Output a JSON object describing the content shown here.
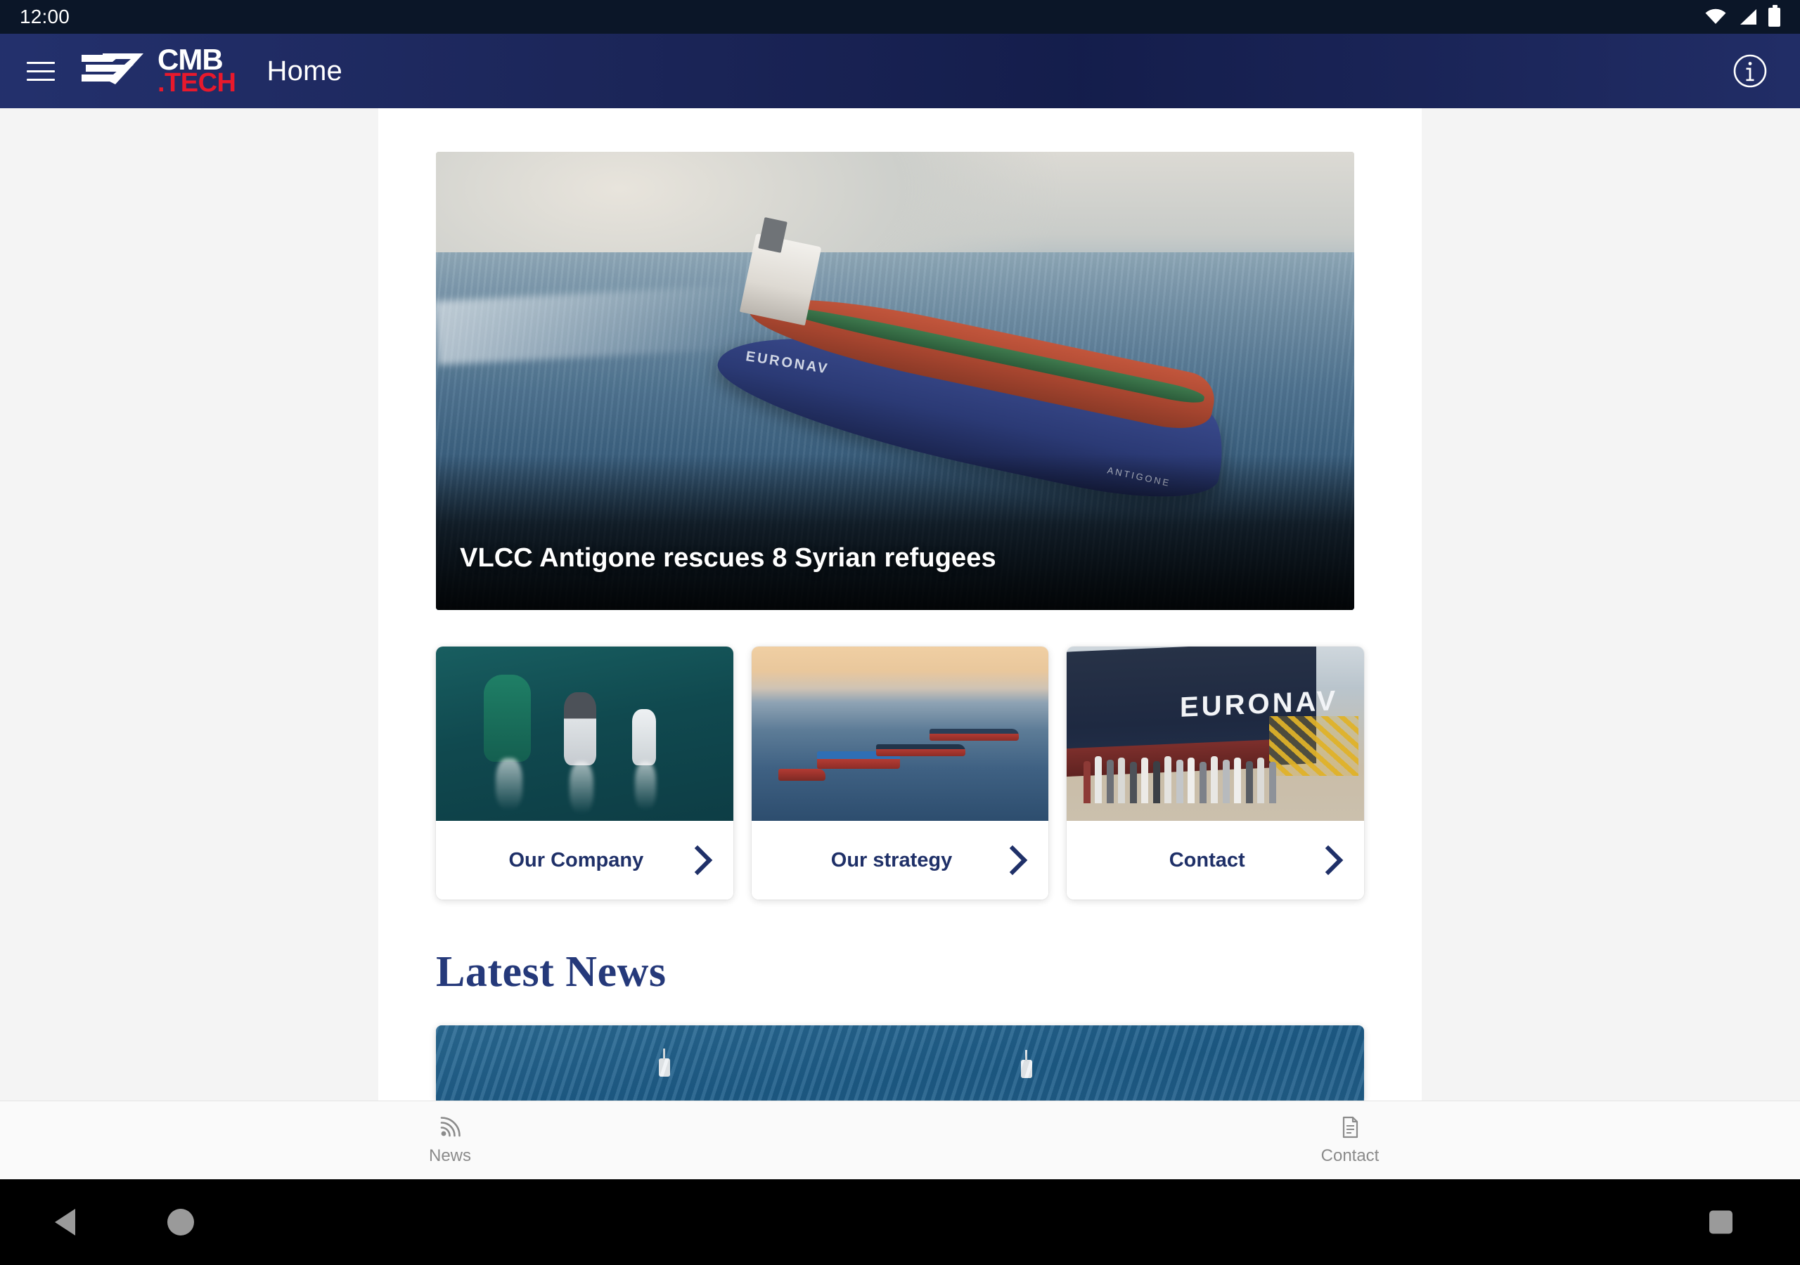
{
  "status_bar": {
    "clock": "12:00",
    "icons": [
      "wifi-icon",
      "signal-icon",
      "battery-icon"
    ]
  },
  "app_bar": {
    "menu_icon": "hamburger-menu-icon",
    "logo": {
      "primary": "CMB",
      "secondary": ".TECH",
      "mark": "cmb-wave-logo-icon"
    },
    "title": "Home",
    "info_icon": "info-circle-icon",
    "background_color": "#1d2a61",
    "accent_color": "#e8192c"
  },
  "hero": {
    "caption": "VLCC Antigone rescues 8 Syrian refugees",
    "image_alt": "aerial-photo-of-vlcc-tanker-antigone-at-sea",
    "ship_name": "ANTIGONE",
    "ship_brand": "EURONAV"
  },
  "quick_links": [
    {
      "label": "Our Company",
      "chevron": "chevron-right-icon",
      "image_alt": "aerial-view-of-three-tugboats"
    },
    {
      "label": "Our strategy",
      "chevron": "chevron-right-icon",
      "image_alt": "fleet-of-vessels-at-dusk"
    },
    {
      "label": "Contact",
      "chevron": "chevron-right-icon",
      "image_alt": "group-photo-in-front-of-euronav-vessel",
      "hull_text": "EURONAV"
    }
  ],
  "latest_news": {
    "title": "Latest News",
    "first_card_image_alt": "aerial-view-of-boats-on-blue-sea"
  },
  "tab_bar": {
    "tabs": [
      {
        "label": "News",
        "icon": "rss-feed-icon"
      },
      {
        "label": "Contact",
        "icon": "document-icon"
      }
    ],
    "inactive_color": "#8b8b8b"
  },
  "nav_bar": {
    "back": "back-triangle-icon",
    "home": "home-circle-icon",
    "recents": "recents-square-icon"
  }
}
